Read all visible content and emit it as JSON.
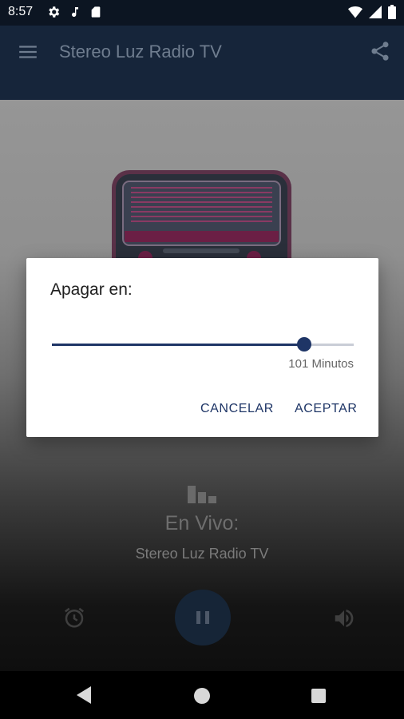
{
  "status_bar": {
    "time": "8:57",
    "left_icons": [
      "settings-icon",
      "music-note-icon",
      "sd-card-icon"
    ],
    "right_icons": [
      "wifi-icon",
      "signal-icon",
      "battery-icon"
    ]
  },
  "app_bar": {
    "title": "Stereo Luz Radio TV",
    "menu_icon": "menu-icon",
    "share_icon": "share-icon"
  },
  "dialog": {
    "title": "Apagar en:",
    "slider": {
      "value_fraction": 0.835,
      "value_text": "101 Minutos"
    },
    "cancel_label": "CANCELAR",
    "accept_label": "ACEPTAR"
  },
  "player": {
    "status_icon": "equalizer-bars-icon",
    "live_label": "En Vivo:",
    "station_name": "Stereo Luz Radio TV",
    "alarm_icon": "alarm-icon",
    "pause_icon": "pause-icon",
    "volume_icon": "volume-icon"
  },
  "nav_bar": {
    "back_icon": "back-icon",
    "home_icon": "home-icon",
    "recent_icon": "recent-apps-icon"
  },
  "colors": {
    "app_bar": "#16253a",
    "accent": "#1e3566",
    "artwork_pink": "#c4175b"
  }
}
